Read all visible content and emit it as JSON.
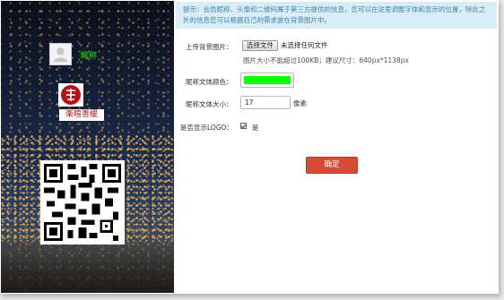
{
  "preview": {
    "nickname": "昵称",
    "logo_text": "楽暄善缓",
    "nickname_color": "#0fff00"
  },
  "tip": {
    "text": "提示：会员昵称、头像和二维码属于第三方提供的信息，您可以在这里调整字体和显示的位置，除此之外的信息您可以根据自己的需求放在背景图片中。"
  },
  "form": {
    "bg_label": "上传背景图片：",
    "file_button": "选择文件",
    "file_status": "未选择任何文件",
    "file_hint": "图片大小不能超过100KB；建议尺寸：640px*1138px",
    "color_label": "昵称文体颜色：",
    "color_value": "#0fff00",
    "size_label": "昵称文体大小：",
    "size_value": "17",
    "size_unit": "像素",
    "logo_label": "是否显示LOGO：",
    "logo_checked": true,
    "logo_option": "是",
    "confirm_button": "确定"
  }
}
